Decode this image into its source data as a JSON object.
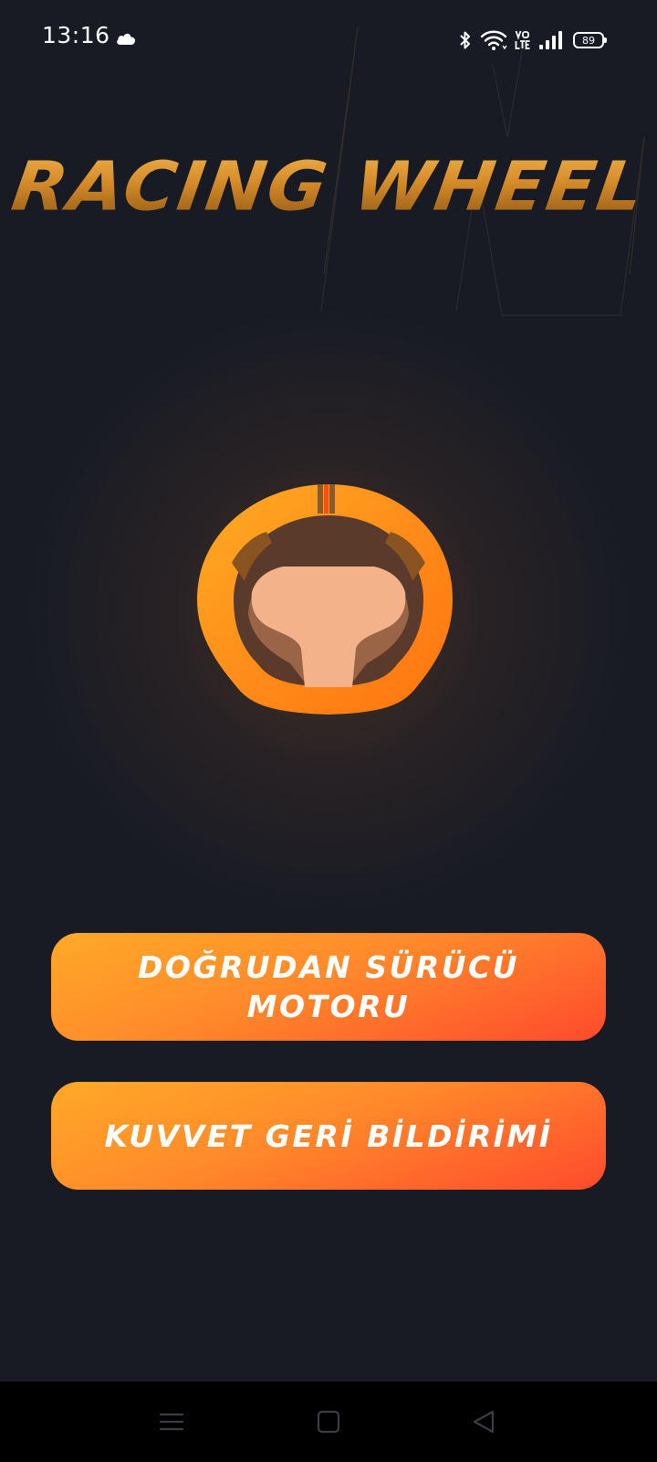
{
  "status_bar": {
    "time": "13:16",
    "battery_level": "89",
    "icons": [
      "cloud-icon",
      "bluetooth-icon",
      "wifi-icon",
      "volte-icon",
      "signal-icon",
      "battery-icon"
    ]
  },
  "app": {
    "title": "RACING WHEEL"
  },
  "buttons": {
    "direct_drive": "DOĞRUDAN SÜRÜCÜ MOTORU",
    "force_feedback": "KUVVET GERİ BİLDİRİMİ"
  },
  "nav": {
    "icons": [
      "menu-icon",
      "home-icon",
      "back-icon"
    ]
  },
  "colors": {
    "background": "#181b24",
    "accent_start": "#ffaa28",
    "accent_end": "#ff4a2c",
    "title_gold": "#d38a28",
    "wheel_orange": "#ff8a1c",
    "wheel_center": "#f4b28a"
  }
}
